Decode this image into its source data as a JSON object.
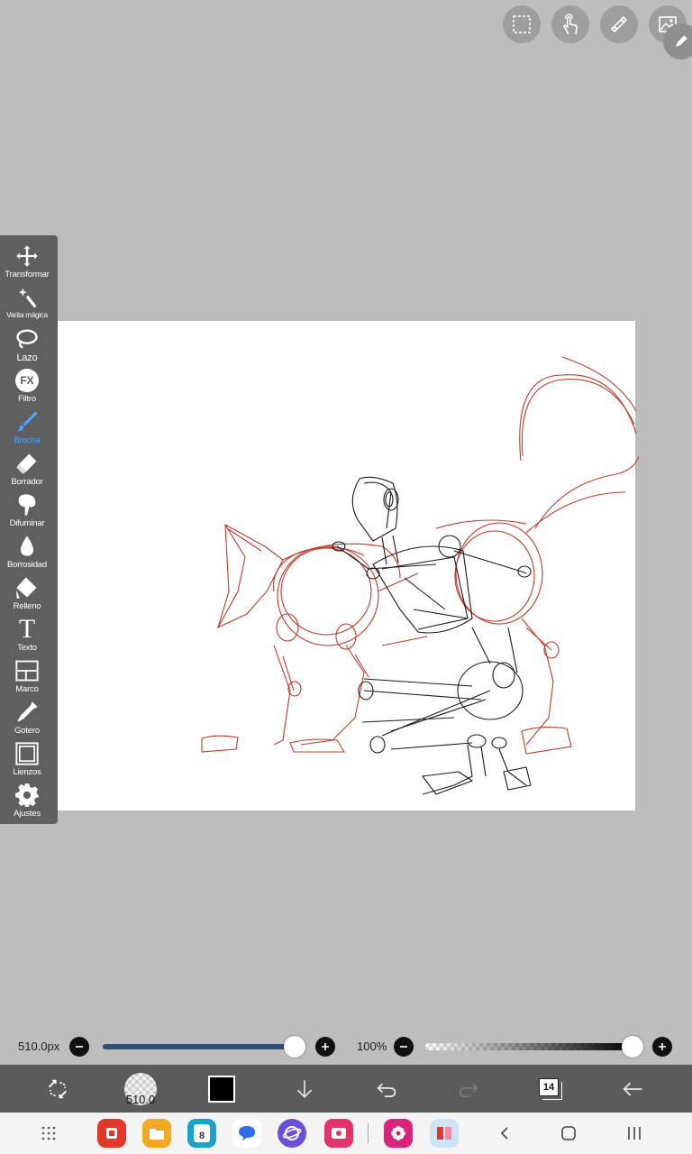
{
  "top_buttons": [
    {
      "icon": "selection-icon"
    },
    {
      "icon": "touch-icon"
    },
    {
      "icon": "ruler-icon"
    },
    {
      "icon": "image-icon"
    }
  ],
  "toolbar": {
    "items": [
      {
        "label": "Transformar",
        "icon": "move-icon"
      },
      {
        "label": "Varita mágica",
        "icon": "magic-wand-icon"
      },
      {
        "label": "Lazo",
        "icon": "lasso-icon"
      },
      {
        "label": "Filtro",
        "icon": "fx-icon",
        "icon_text": "FX"
      },
      {
        "label": "Brocha",
        "icon": "brush-icon",
        "active": true
      },
      {
        "label": "Borrador",
        "icon": "eraser-icon"
      },
      {
        "label": "Difuminar",
        "icon": "blur-icon"
      },
      {
        "label": "Borrosidad",
        "icon": "drop-icon"
      },
      {
        "label": "Relleno",
        "icon": "fill-icon"
      },
      {
        "label": "Texto",
        "icon": "text-icon",
        "icon_text": "T"
      },
      {
        "label": "Marco",
        "icon": "frame-icon"
      },
      {
        "label": "Gotero",
        "icon": "eyedropper-icon"
      },
      {
        "label": "Lienzos",
        "icon": "canvas-icon"
      },
      {
        "label": "Ajustes",
        "icon": "gear-icon"
      }
    ]
  },
  "brush": {
    "size_label": "510.0px",
    "size_value": 0.96,
    "preview_label": "510.0"
  },
  "opacity": {
    "label": "100%",
    "value": 1.0
  },
  "colors": {
    "toolbar_bg": "#5f5f5f",
    "active": "#4aa3ff",
    "sketch_red": "#c0392b",
    "sketch_black": "#1a1a1a",
    "current_color": "#000000"
  },
  "action_bar": {
    "layer_count": "14"
  },
  "nav_bar": {
    "apps": [
      "grid-icon",
      "flipboard-icon",
      "files-icon",
      "calendar-icon",
      "messages-icon",
      "internet-icon",
      "screen-recorder-icon",
      "gallery-icon",
      "library-icon"
    ]
  }
}
